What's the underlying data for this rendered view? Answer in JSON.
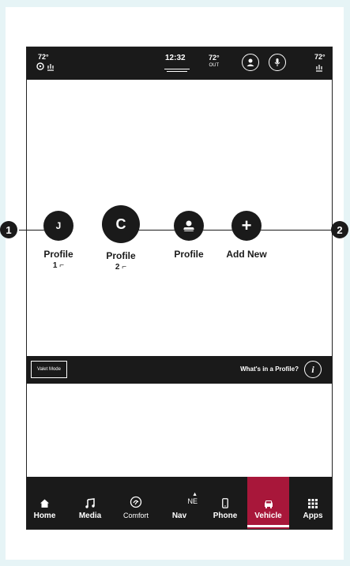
{
  "status_bar": {
    "left_temp": "72°",
    "clock": "12:32",
    "outside_temp": "72°",
    "outside_label": "OUT",
    "right_temp": "72°",
    "icons": [
      "steering-heat-icon",
      "seat-heat-icon",
      "profile-icon",
      "microphone-icon",
      "seat-heat-rear-icon"
    ]
  },
  "profiles": [
    {
      "initial": "J",
      "label": "Profile",
      "sub": "1"
    },
    {
      "initial": "C",
      "label": "Profile",
      "sub": "2"
    },
    {
      "initial": "",
      "label": "Profile",
      "sub": ""
    },
    {
      "initial": "+",
      "label": "Add New",
      "sub": ""
    }
  ],
  "valet": {
    "button_label": "Valet Mode",
    "whats_in_profile": "What's in a Profile?",
    "info_glyph": "i"
  },
  "nav": {
    "items": [
      {
        "label": "Home",
        "icon": "home-icon"
      },
      {
        "label": "Media",
        "icon": "music-icon"
      },
      {
        "label": "Comfort",
        "icon": "comfort-icon"
      },
      {
        "label": "Nav",
        "icon": "compass-icon",
        "compass": "NE"
      },
      {
        "label": "Phone",
        "icon": "phone-icon"
      },
      {
        "label": "Vehicle",
        "icon": "car-icon"
      },
      {
        "label": "Apps",
        "icon": "apps-grid-icon"
      }
    ],
    "active": "Vehicle"
  },
  "callouts": [
    "1",
    "2"
  ],
  "colors": {
    "bar": "#1a1a1a",
    "active": "#a8173a",
    "background": "#e6f4f6"
  }
}
